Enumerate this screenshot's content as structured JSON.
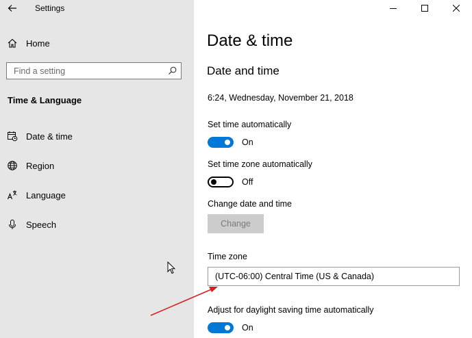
{
  "window": {
    "title": "Settings",
    "colors": {
      "accent": "#0078d7",
      "sidebar_bg": "#e6e6e6",
      "annotation_arrow": "#d42020"
    }
  },
  "sidebar": {
    "home_label": "Home",
    "search_placeholder": "Find a setting",
    "section_title": "Time & Language",
    "items": [
      {
        "label": "Date & time",
        "icon": "calendar-clock-icon"
      },
      {
        "label": "Region",
        "icon": "globe-icon"
      },
      {
        "label": "Language",
        "icon": "language-icon"
      },
      {
        "label": "Speech",
        "icon": "microphone-icon"
      }
    ]
  },
  "main": {
    "page_title": "Date & time",
    "section_title": "Date and time",
    "current_datetime": "6:24, Wednesday, November 21, 2018",
    "set_time_auto": {
      "label": "Set time automatically",
      "state": "On"
    },
    "set_timezone_auto": {
      "label": "Set time zone automatically",
      "state": "Off"
    },
    "change_datetime": {
      "label": "Change date and time",
      "button": "Change"
    },
    "time_zone": {
      "label": "Time zone",
      "value": "(UTC-06:00) Central Time (US & Canada)"
    },
    "daylight": {
      "label": "Adjust for daylight saving time automatically",
      "state": "On"
    }
  }
}
